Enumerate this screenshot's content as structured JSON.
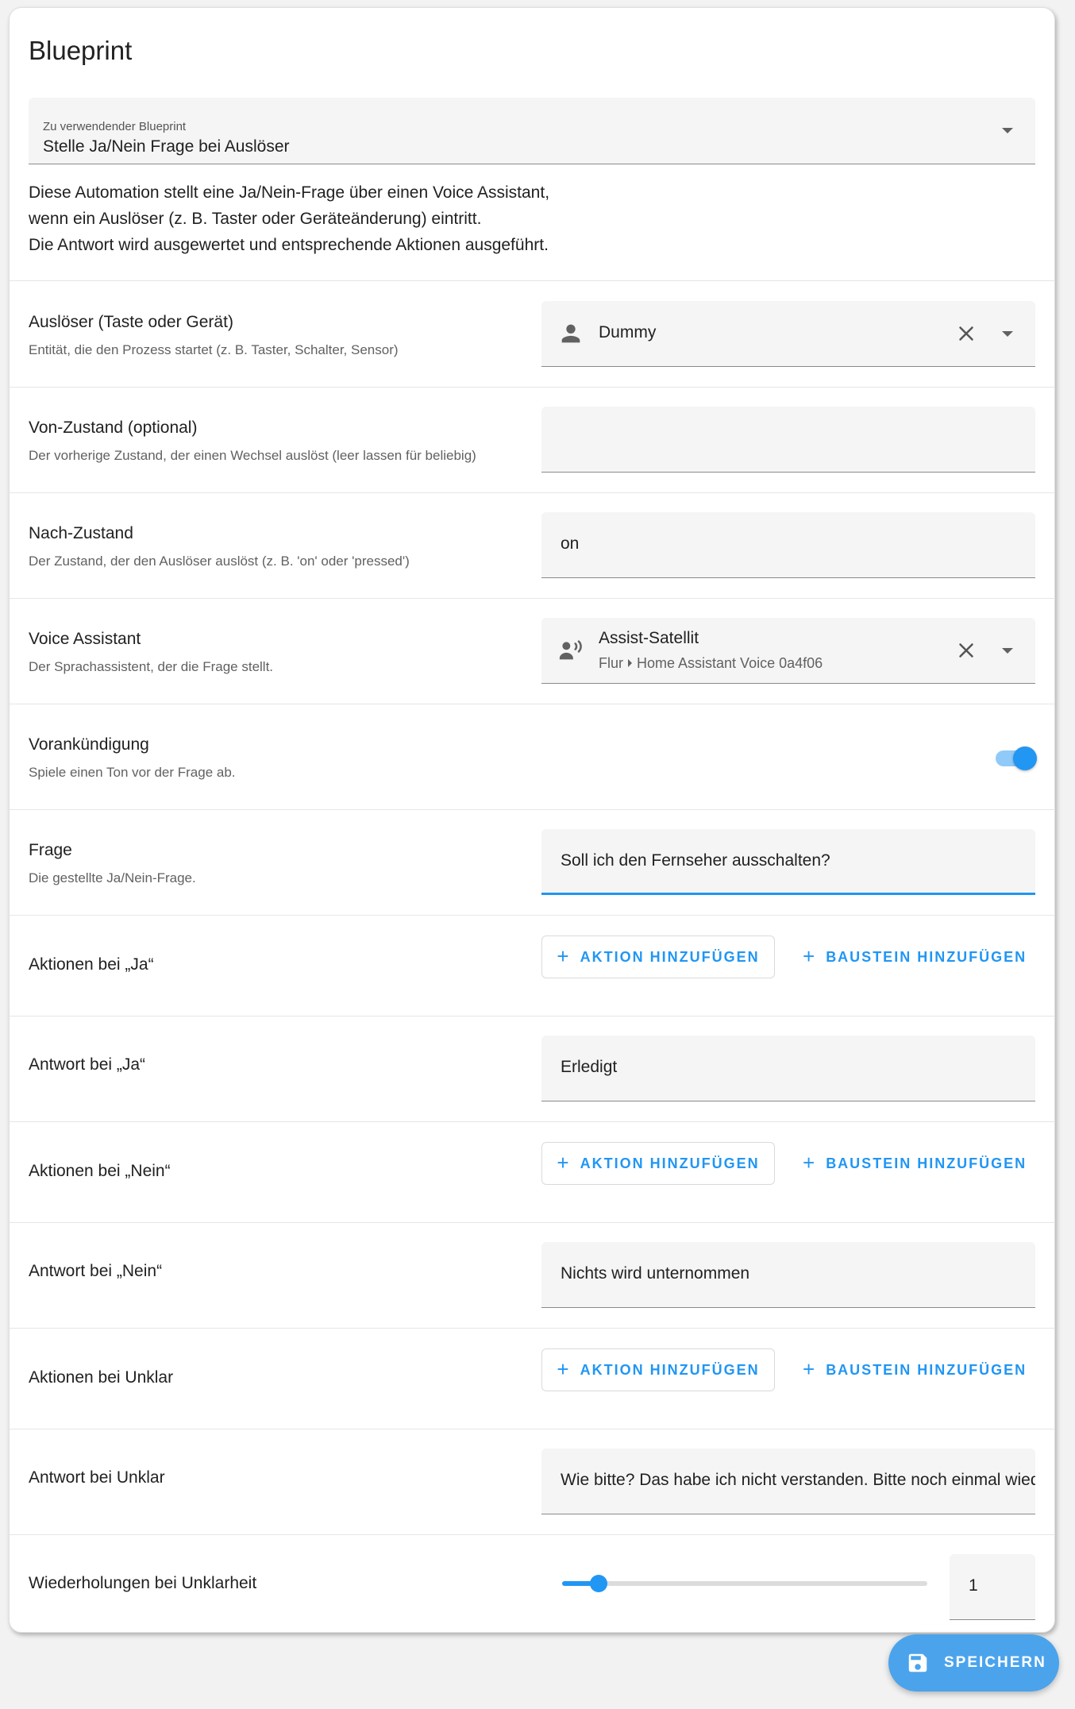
{
  "card": {
    "title": "Blueprint"
  },
  "blueprint": {
    "label": "Zu verwendender Blueprint",
    "value": "Stelle Ja/Nein Frage bei Auslöser",
    "description": [
      "Diese Automation stellt eine Ja/Nein-Frage über einen Voice Assistant,",
      "wenn ein Auslöser (z. B. Taster oder Geräteänderung) eintritt.",
      "Die Antwort wird ausgewertet und entsprechende Aktionen ausgeführt."
    ]
  },
  "fields": {
    "trigger": {
      "label": "Auslöser (Taste oder Gerät)",
      "sublabel": "Entität, die den Prozess startet (z. B. Taster, Schalter, Sensor)",
      "value": "Dummy",
      "icon": "person-icon"
    },
    "from_state": {
      "label": "Von-Zustand (optional)",
      "sublabel": "Der vorherige Zustand, der einen Wechsel auslöst (leer lassen für beliebig)",
      "value": ""
    },
    "to_state": {
      "label": "Nach-Zustand",
      "sublabel": "Der Zustand, der den Auslöser auslöst (z. B. 'on' oder 'pressed')",
      "value": "on"
    },
    "voice_assistant": {
      "label": "Voice Assistant",
      "sublabel": "Der Sprachassistent, der die Frage stellt.",
      "value": "Assist-Satellit",
      "area": "Flur",
      "device": "Home Assistant Voice 0a4f06",
      "icon": "assist-satellite-icon"
    },
    "announcement": {
      "label": "Vorankündigung",
      "sublabel": "Spiele einen Ton vor der Frage ab.",
      "enabled": true
    },
    "question": {
      "label": "Frage",
      "sublabel": "Die gestellte Ja/Nein-Frage.",
      "value": "Soll ich den Fernseher ausschalten?"
    },
    "actions_yes": {
      "label": "Aktionen bei „Ja“"
    },
    "answer_yes": {
      "label": "Antwort bei „Ja“",
      "value": "Erledigt"
    },
    "actions_no": {
      "label": "Aktionen bei „Nein“"
    },
    "answer_no": {
      "label": "Antwort bei „Nein“",
      "value": "Nichts wird unternommen"
    },
    "actions_unclear": {
      "label": "Aktionen bei Unklar"
    },
    "answer_unclear": {
      "label": "Antwort bei Unklar",
      "value": "Wie bitte? Das habe ich nicht verstanden. Bitte noch einmal wiederholen."
    },
    "retries": {
      "label": "Wiederholungen bei Unklarheit",
      "value": "1",
      "slider_fraction": 0.1
    }
  },
  "buttons": {
    "add_action": "AKTION HINZUFÜGEN",
    "add_building_block": "BAUSTEIN HINZUFÜGEN",
    "save": "SPEICHERN"
  },
  "colors": {
    "accent": "#2196f3",
    "fab": "#4ba3ec",
    "field_bg": "#f5f5f5"
  }
}
